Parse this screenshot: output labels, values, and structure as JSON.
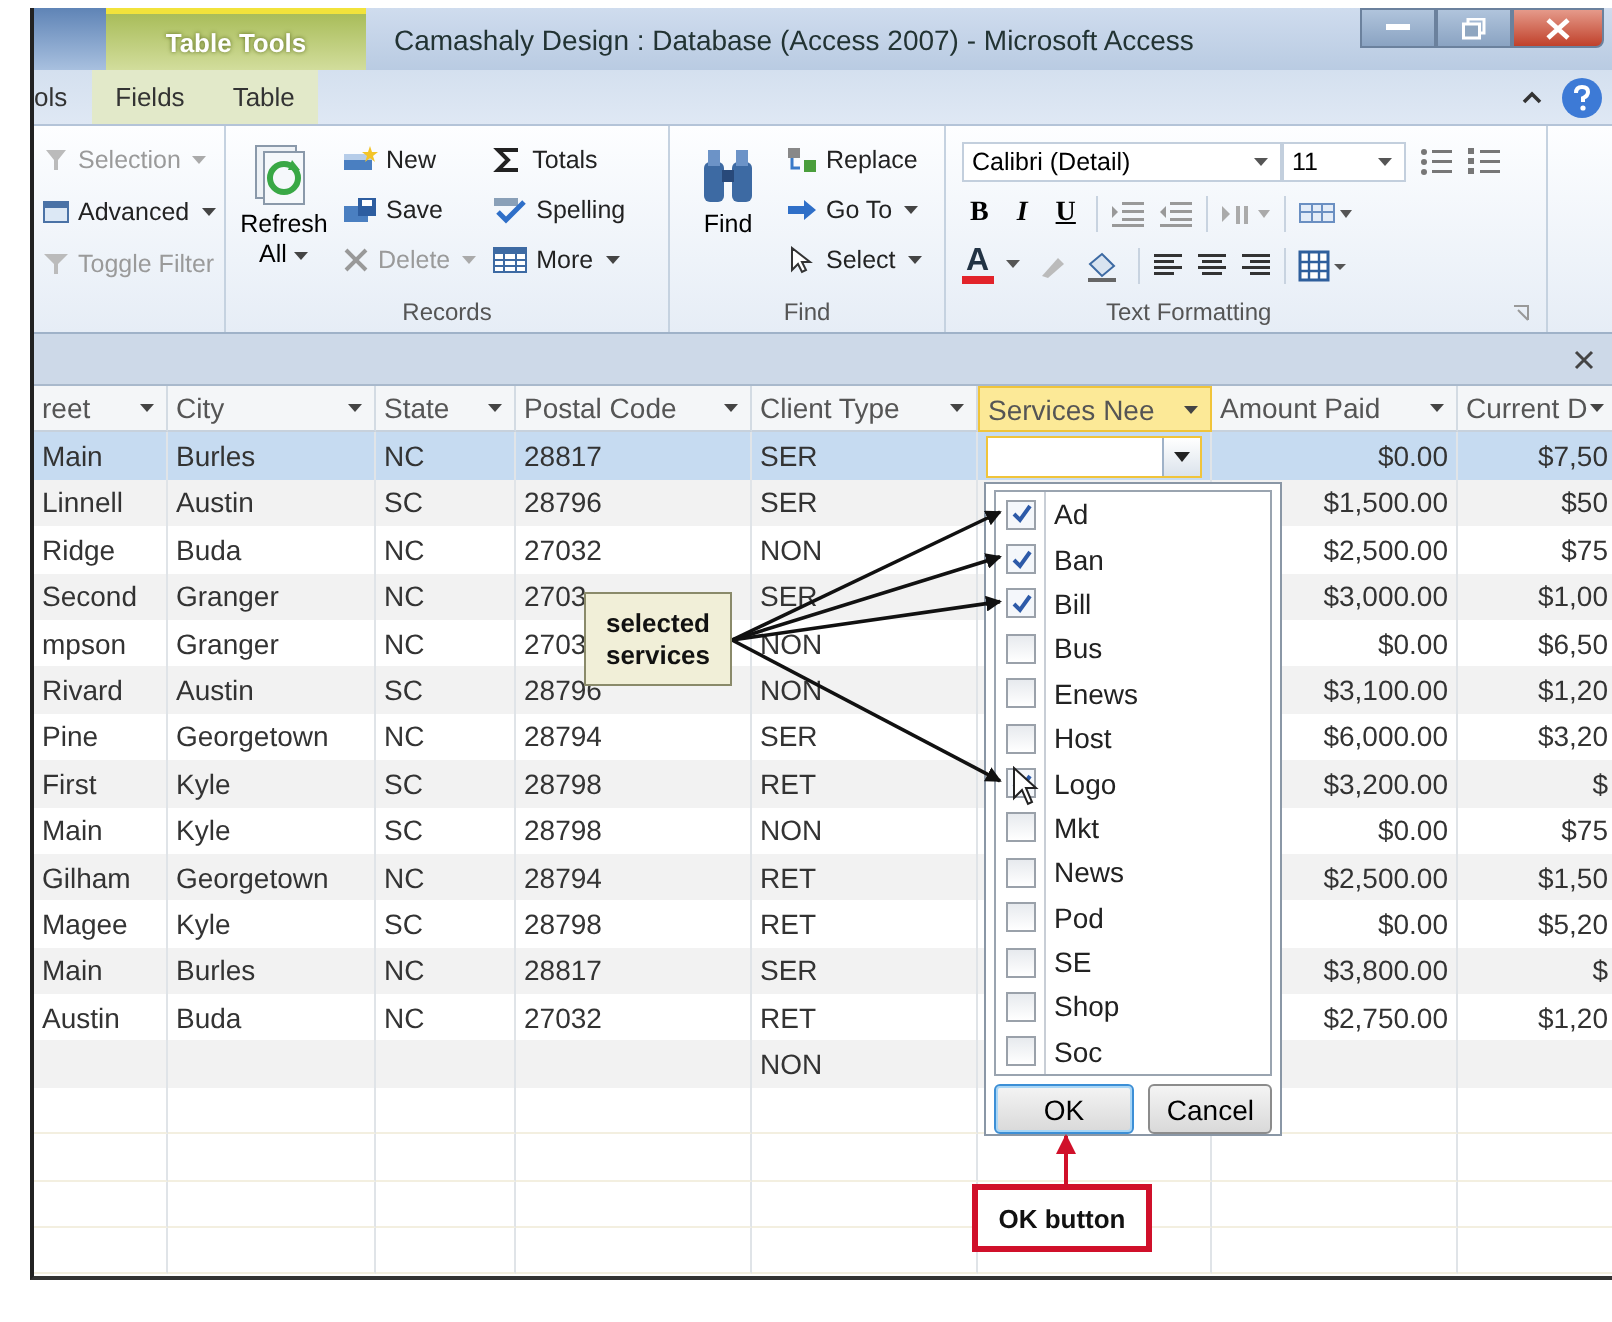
{
  "window": {
    "title": "Camashaly Design : Database (Access 2007)  -  Microsoft Access",
    "contextual_group": "Table Tools"
  },
  "tabs": [
    {
      "label": "ols",
      "selected": false,
      "contextual": false
    },
    {
      "label": "Fields",
      "selected": false,
      "contextual": true
    },
    {
      "label": "Table",
      "selected": false,
      "contextual": true
    }
  ],
  "ribbon": {
    "groups": [
      {
        "kind": "stack",
        "commands": [
          {
            "label": "Selection",
            "disabled": true,
            "dropdown": true
          },
          {
            "label": "Advanced",
            "disabled": false,
            "dropdown": true
          },
          {
            "label": "Toggle Filter",
            "disabled": true,
            "dropdown": false
          }
        ]
      },
      {
        "kind": "records",
        "label": "Records",
        "large": {
          "label": "Refresh",
          "sublabel": "All",
          "dropdown": true
        },
        "commands": [
          {
            "label": "New",
            "disabled": false,
            "dropdown": false
          },
          {
            "label": "Save",
            "disabled": false,
            "dropdown": false
          },
          {
            "label": "Delete",
            "disabled": true,
            "dropdown": true
          },
          {
            "label": "Totals",
            "disabled": false,
            "dropdown": false
          },
          {
            "label": "Spelling",
            "disabled": false,
            "dropdown": false
          },
          {
            "label": "More",
            "disabled": false,
            "dropdown": true
          }
        ]
      },
      {
        "kind": "find",
        "label": "Find",
        "large": {
          "label": "Find"
        },
        "commands": [
          {
            "label": "Replace",
            "disabled": false,
            "dropdown": false
          },
          {
            "label": "Go To",
            "disabled": false,
            "dropdown": true
          },
          {
            "label": "Select",
            "disabled": false,
            "dropdown": true
          }
        ]
      },
      {
        "kind": "text_formatting",
        "label": "Text Formatting",
        "font": "Calibri (Detail)",
        "size": "11",
        "style_buttons": [
          "B",
          "I",
          "U"
        ],
        "font_color_letter": "A"
      }
    ]
  },
  "table": {
    "columns": [
      {
        "label": "reet",
        "active": false
      },
      {
        "label": "City",
        "active": false
      },
      {
        "label": "State",
        "active": false
      },
      {
        "label": "Postal Code",
        "active": false
      },
      {
        "label": "Client Type",
        "active": false
      },
      {
        "label": "Services Nee",
        "active": true
      },
      {
        "label": "Amount Paid",
        "active": false
      },
      {
        "label": "Current D",
        "active": false
      }
    ],
    "rows": [
      {
        "selected": true,
        "cells": [
          "Main",
          "Burles",
          "NC",
          "28817",
          "SER",
          null,
          "$0.00",
          "$7,50"
        ]
      },
      {
        "selected": false,
        "cells": [
          "Linnell",
          "Austin",
          "SC",
          "28796",
          "SER",
          null,
          "$1,500.00",
          "$50"
        ]
      },
      {
        "selected": false,
        "cells": [
          "Ridge",
          "Buda",
          "NC",
          "27032",
          "NON",
          null,
          "$2,500.00",
          "$75"
        ]
      },
      {
        "selected": false,
        "cells": [
          "Second",
          "Granger",
          "NC",
          "2703",
          "SER",
          null,
          "$3,000.00",
          "$1,00"
        ]
      },
      {
        "selected": false,
        "cells": [
          "mpson",
          "Granger",
          "NC",
          "2703",
          "NON",
          null,
          "$0.00",
          "$6,50"
        ]
      },
      {
        "selected": false,
        "cells": [
          "Rivard",
          "Austin",
          "SC",
          "28796",
          "NON",
          null,
          "$3,100.00",
          "$1,20"
        ]
      },
      {
        "selected": false,
        "cells": [
          "Pine",
          "Georgetown",
          "NC",
          "28794",
          "SER",
          null,
          "$6,000.00",
          "$3,20"
        ]
      },
      {
        "selected": false,
        "cells": [
          "First",
          "Kyle",
          "SC",
          "28798",
          "RET",
          null,
          "$3,200.00",
          "$"
        ]
      },
      {
        "selected": false,
        "cells": [
          "Main",
          "Kyle",
          "SC",
          "28798",
          "NON",
          null,
          "$0.00",
          "$75"
        ]
      },
      {
        "selected": false,
        "cells": [
          "Gilham",
          "Georgetown",
          "NC",
          "28794",
          "RET",
          null,
          "$2,500.00",
          "$1,50"
        ]
      },
      {
        "selected": false,
        "cells": [
          "Magee",
          "Kyle",
          "SC",
          "28798",
          "RET",
          null,
          "$0.00",
          "$5,20"
        ]
      },
      {
        "selected": false,
        "cells": [
          "Main",
          "Burles",
          "NC",
          "28817",
          "SER",
          null,
          "$3,800.00",
          "$"
        ]
      },
      {
        "selected": false,
        "cells": [
          "Austin",
          "Buda",
          "NC",
          "27032",
          "RET",
          null,
          "$2,750.00",
          "$1,20"
        ]
      },
      {
        "selected": false,
        "cells": [
          null,
          null,
          null,
          null,
          "NON",
          null,
          null,
          null
        ]
      }
    ]
  },
  "services_dropdown": {
    "options": [
      {
        "label": "Ad",
        "checked": true,
        "pointed": true
      },
      {
        "label": "Ban",
        "checked": true,
        "pointed": true
      },
      {
        "label": "Bill",
        "checked": true,
        "pointed": true
      },
      {
        "label": "Bus",
        "checked": false,
        "pointed": false
      },
      {
        "label": "Enews",
        "checked": false,
        "pointed": false
      },
      {
        "label": "Host",
        "checked": false,
        "pointed": false
      },
      {
        "label": "Logo",
        "checked": true,
        "pointed": true
      },
      {
        "label": "Mkt",
        "checked": false,
        "pointed": false
      },
      {
        "label": "News",
        "checked": false,
        "pointed": false
      },
      {
        "label": "Pod",
        "checked": false,
        "pointed": false
      },
      {
        "label": "SE",
        "checked": false,
        "pointed": false
      },
      {
        "label": "Shop",
        "checked": false,
        "pointed": false
      },
      {
        "label": "Soc",
        "checked": false,
        "pointed": false
      }
    ],
    "buttons": [
      {
        "label": "OK",
        "focused": true
      },
      {
        "label": "Cancel",
        "focused": false
      }
    ]
  },
  "callouts": [
    {
      "kind": "note",
      "text": "selected services"
    },
    {
      "kind": "label",
      "text": "OK button"
    }
  ]
}
